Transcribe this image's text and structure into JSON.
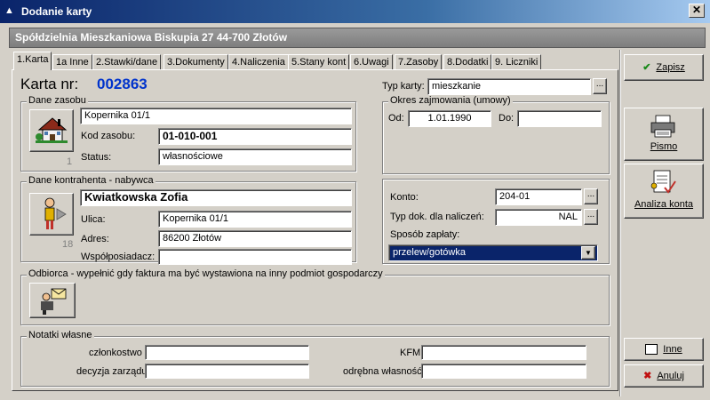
{
  "window": {
    "title": "Dodanie karty",
    "close_glyph": "✕"
  },
  "header": {
    "text": "Spółdzielnia Mieszkaniowa Biskupia 27  44-700 Złotów"
  },
  "tabs": [
    {
      "label": "1.Karta"
    },
    {
      "label": "1a Inne"
    },
    {
      "label": "2.Stawki/dane"
    },
    {
      "label": "3.Dokumenty"
    },
    {
      "label": "4.Naliczenia"
    },
    {
      "label": "5.Stany kont"
    },
    {
      "label": "6.Uwagi"
    },
    {
      "label": "7.Zasoby"
    },
    {
      "label": "8.Dodatki"
    },
    {
      "label": "9. Liczniki"
    }
  ],
  "karta": {
    "label": "Karta nr:",
    "number": "002863",
    "number_color": "#0033cc",
    "typ_karty_label": "Typ karty:",
    "typ_karty_value": "mieszkanie"
  },
  "dane_zasobu": {
    "title": "Dane zasobu",
    "address": "Kopernika 01/1",
    "kod_label": "Kod zasobu:",
    "kod_value": "01-010-001",
    "status_label": "Status:",
    "status_value": "własnościowe",
    "count": "1",
    "icon": "house-icon"
  },
  "okres": {
    "title": "Okres zajmowania (umowy)",
    "od_label": "Od:",
    "od_value": "1.01.1990",
    "do_label": "Do:",
    "do_value": ""
  },
  "kontrahent": {
    "title": "Dane kontrahenta - nabywca",
    "name": "Kwiatkowska Zofia",
    "ulica_label": "Ulica:",
    "ulica_value": "Kopernika 01/1",
    "adres_label": "Adres:",
    "adres_value": "86200 Złotów",
    "wspolposiadacz_label": "Współposiadacz:",
    "wspolposiadacz_value": "",
    "count": "18",
    "icon": "person-icon"
  },
  "konto": {
    "konto_label": "Konto:",
    "konto_value": "204-01",
    "typ_dok_label": "Typ dok. dla naliczeń:",
    "typ_dok_value": "NAL",
    "sposob_label": "Sposób zapłaty:",
    "sposob_value": "przelew/gotówka",
    "ellipsis": "..."
  },
  "odbiorca": {
    "title": "Odbiorca - wypełnić gdy faktura ma być wystawiona na inny podmiot gospodarczy",
    "icon": "mail-person-icon"
  },
  "notatki": {
    "title": "Notatki własne",
    "czlonkostwo_label": "członkostwo",
    "czlonkostwo_value": "",
    "kfm_label": "KFM",
    "kfm_value": "",
    "decyzja_label": "decyzja zarządu",
    "decyzja_value": "",
    "odrebna_label": "odrębna własność",
    "odrebna_value": ""
  },
  "side_buttons": {
    "zapisz": "Zapisz",
    "pismo": "Pismo",
    "analiza": "Analiza konta",
    "inne": "Inne",
    "anuluj": "Anuluj"
  },
  "colors": {
    "titlebar": "#0a246a",
    "header_strip": "#808080",
    "dropdown_selected": "#0a246a"
  }
}
